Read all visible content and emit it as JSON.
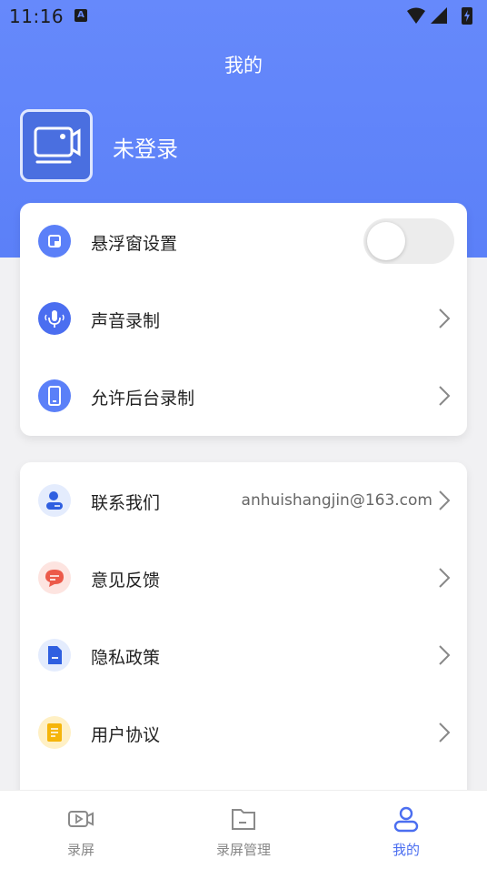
{
  "status_bar": {
    "time": "11:16",
    "notification_icon": "A"
  },
  "header": {
    "title": "我的"
  },
  "profile": {
    "login_text": "未登录",
    "avatar_icon": "screen-record-icon"
  },
  "settings_card": {
    "items": [
      {
        "label": "悬浮窗设置",
        "icon": "floating-window-icon",
        "control": "toggle",
        "toggle_on": false
      },
      {
        "label": "声音录制",
        "icon": "microphone-icon",
        "control": "chevron"
      },
      {
        "label": "允许后台录制",
        "icon": "phone-icon",
        "control": "chevron"
      }
    ]
  },
  "info_card": {
    "items": [
      {
        "label": "联系我们",
        "value": "anhuishangjin@163.com",
        "icon": "contact-icon"
      },
      {
        "label": "意见反馈",
        "icon": "feedback-icon"
      },
      {
        "label": "隐私政策",
        "icon": "privacy-icon"
      },
      {
        "label": "用户协议",
        "icon": "agreement-icon"
      }
    ]
  },
  "tab_bar": {
    "tabs": [
      {
        "label": "录屏",
        "icon": "record-icon",
        "active": false
      },
      {
        "label": "录屏管理",
        "icon": "folder-icon",
        "active": false
      },
      {
        "label": "我的",
        "icon": "user-icon",
        "active": true
      }
    ]
  },
  "colors": {
    "accent": "#5b80f8",
    "active_tab": "#4b6ef0"
  }
}
